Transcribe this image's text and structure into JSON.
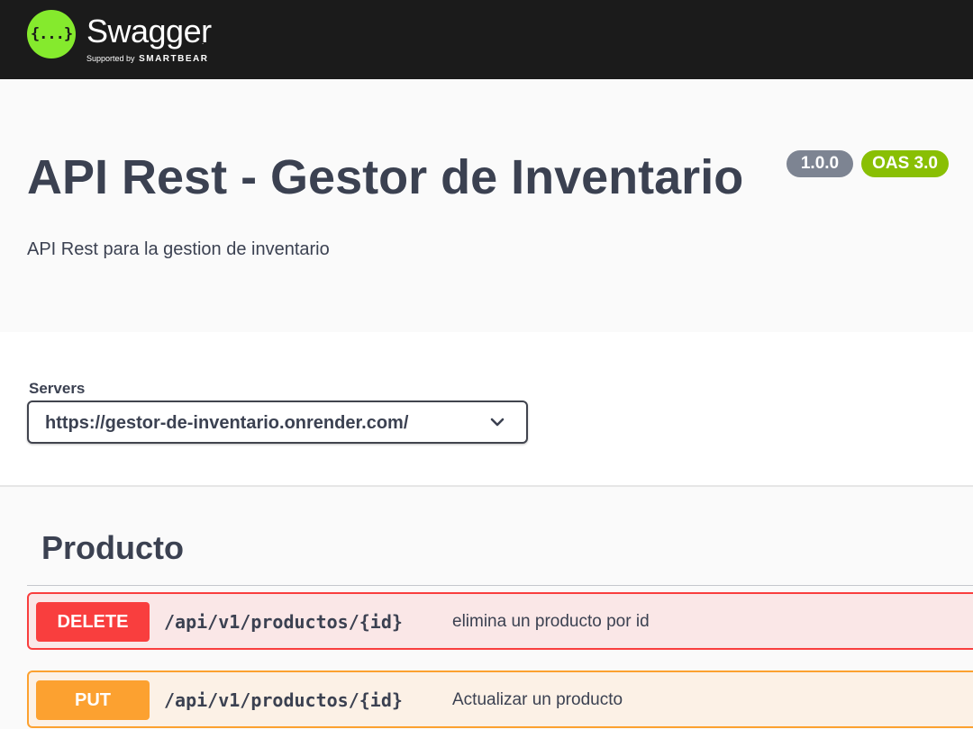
{
  "topbar": {
    "logo_glyph": "{...}",
    "logo_word": "Swagger",
    "logo_tm": ".",
    "supported_by": "Supported by",
    "smartbear": "SMARTBEAR",
    "logo_color": "#85ea2d",
    "background": "#1b1b1b"
  },
  "info": {
    "title": "API Rest - Gestor de Inventario",
    "version": "1.0.0",
    "oas": "OAS 3.0",
    "description": "API Rest para la gestion de inventario"
  },
  "servers": {
    "label": "Servers",
    "selected": "https://gestor-de-inventario.onrender.com/"
  },
  "tag": {
    "name": "Producto"
  },
  "operations": [
    {
      "method": "DELETE",
      "path": "/api/v1/productos/{id}",
      "summary": "elimina un producto por id",
      "color": "#f93e3e"
    },
    {
      "method": "PUT",
      "path": "/api/v1/productos/{id}",
      "summary": "Actualizar un producto",
      "color": "#fca130"
    }
  ]
}
